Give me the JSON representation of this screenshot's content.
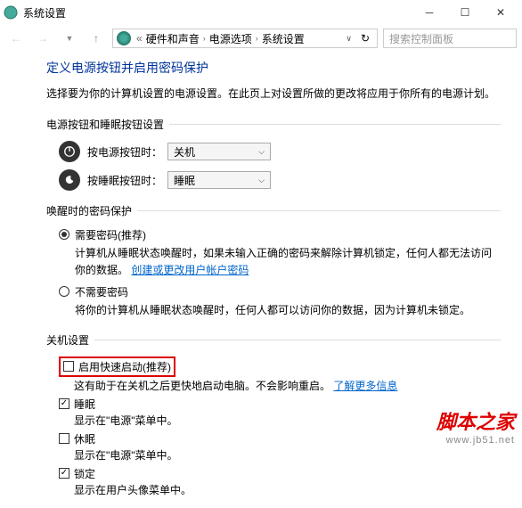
{
  "titlebar": {
    "title": "系统设置"
  },
  "breadcrumb": {
    "parts": [
      "硬件和声音",
      "电源选项",
      "系统设置"
    ],
    "search_placeholder": "搜索控制面板"
  },
  "page": {
    "title": "定义电源按钮并启用密码保护",
    "desc": "选择要为你的计算机设置的电源设置。在此页上对设置所做的更改将应用于你所有的电源计划。"
  },
  "section_buttons": {
    "header": "电源按钮和睡眠按钮设置",
    "rows": [
      {
        "label": "按电源按钮时：",
        "value": "关机"
      },
      {
        "label": "按睡眠按钮时：",
        "value": "睡眠"
      }
    ]
  },
  "section_password": {
    "header": "唤醒时的密码保护",
    "options": [
      {
        "checked": true,
        "label": "需要密码(推荐)",
        "desc_a": "计算机从睡眠状态唤醒时，如果未输入正确的密码来解除计算机锁定，任何人都无法访问你的数据。",
        "link": "创建或更改用户帐户密码"
      },
      {
        "checked": false,
        "label": "不需要密码",
        "desc_a": "将你的计算机从睡眠状态唤醒时，任何人都可以访问你的数据，因为计算机未锁定。"
      }
    ]
  },
  "section_shutdown": {
    "header": "关机设置",
    "items": [
      {
        "checked": false,
        "highlighted": true,
        "label": "启用快速启动(推荐)",
        "desc": "这有助于在关机之后更快地启动电脑。不会影响重启。",
        "link": "了解更多信息"
      },
      {
        "checked": true,
        "label": "睡眠",
        "desc": "显示在\"电源\"菜单中。"
      },
      {
        "checked": false,
        "label": "休眠",
        "desc": "显示在\"电源\"菜单中。"
      },
      {
        "checked": true,
        "label": "锁定",
        "desc": "显示在用户头像菜单中。"
      }
    ]
  },
  "watermark": {
    "line1": "脚本之家",
    "line2": "www.jb51.net"
  }
}
